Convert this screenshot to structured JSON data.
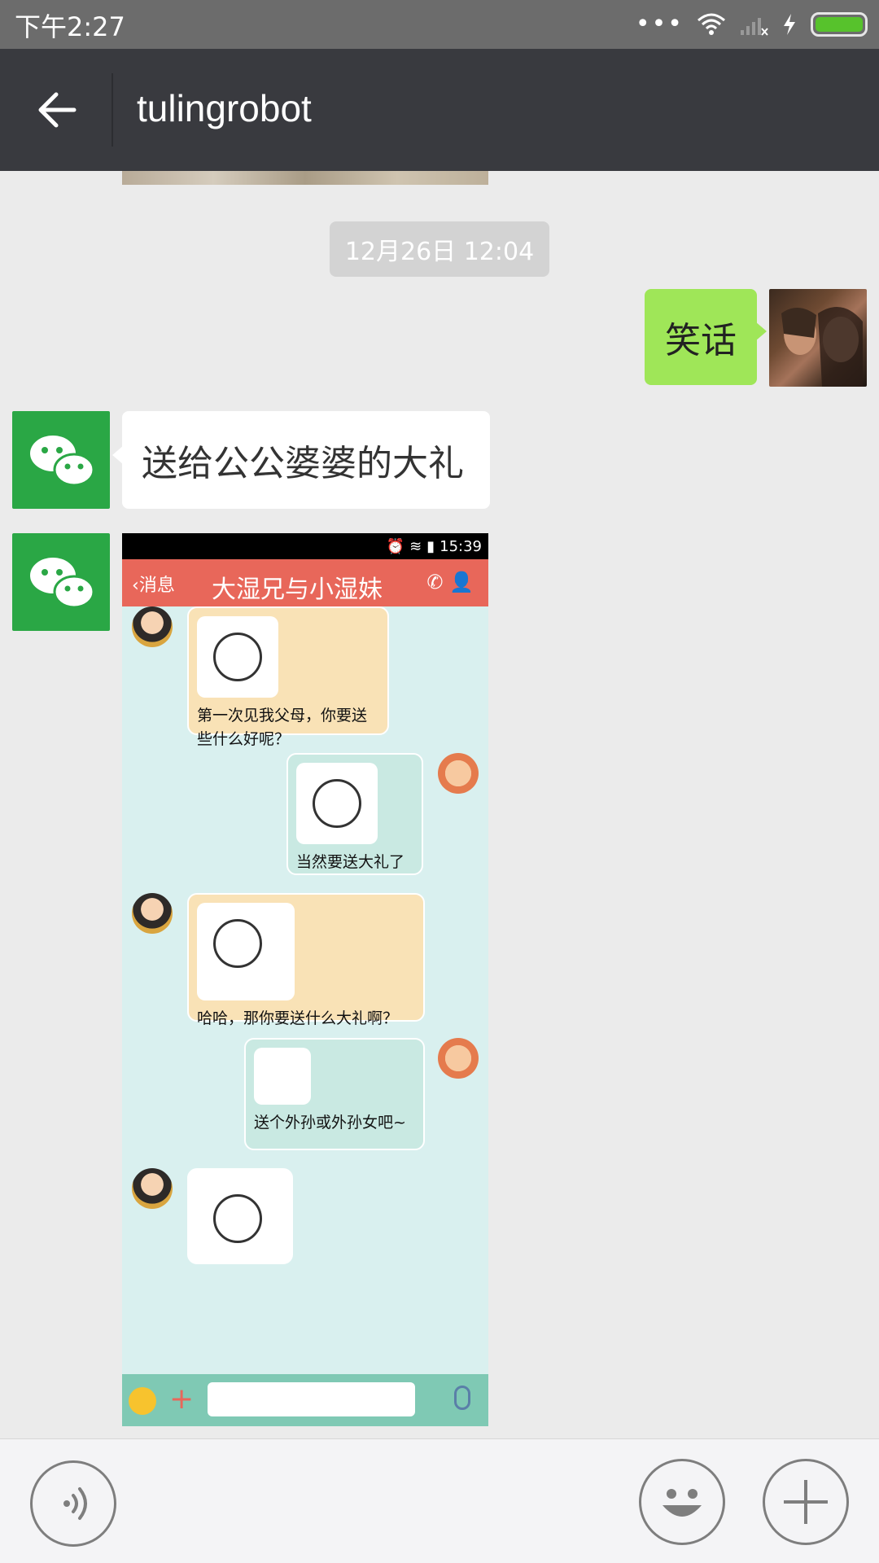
{
  "status_bar": {
    "time": "下午2:27",
    "more": "•••"
  },
  "header": {
    "title": "tulingrobot"
  },
  "chat": {
    "timestamp": "12月26日 12:04",
    "messages": [
      {
        "from": "me",
        "text": "笑话"
      },
      {
        "from": "bot",
        "text": "送给公公婆婆的大礼"
      }
    ],
    "image": {
      "status_time": "15:39",
      "back_label": "消息",
      "title": "大湿兄与小湿妹",
      "bubbles": [
        "第一次见我父母，你要送些什么好呢？",
        "当然要送大礼了",
        "哈哈，那你要送什么大礼啊？",
        "送个外孙或外孙女吧~"
      ]
    }
  },
  "colors": {
    "header": "#393a3f",
    "my_bubble": "#9fe658",
    "bot_avatar": "#2aa745"
  }
}
